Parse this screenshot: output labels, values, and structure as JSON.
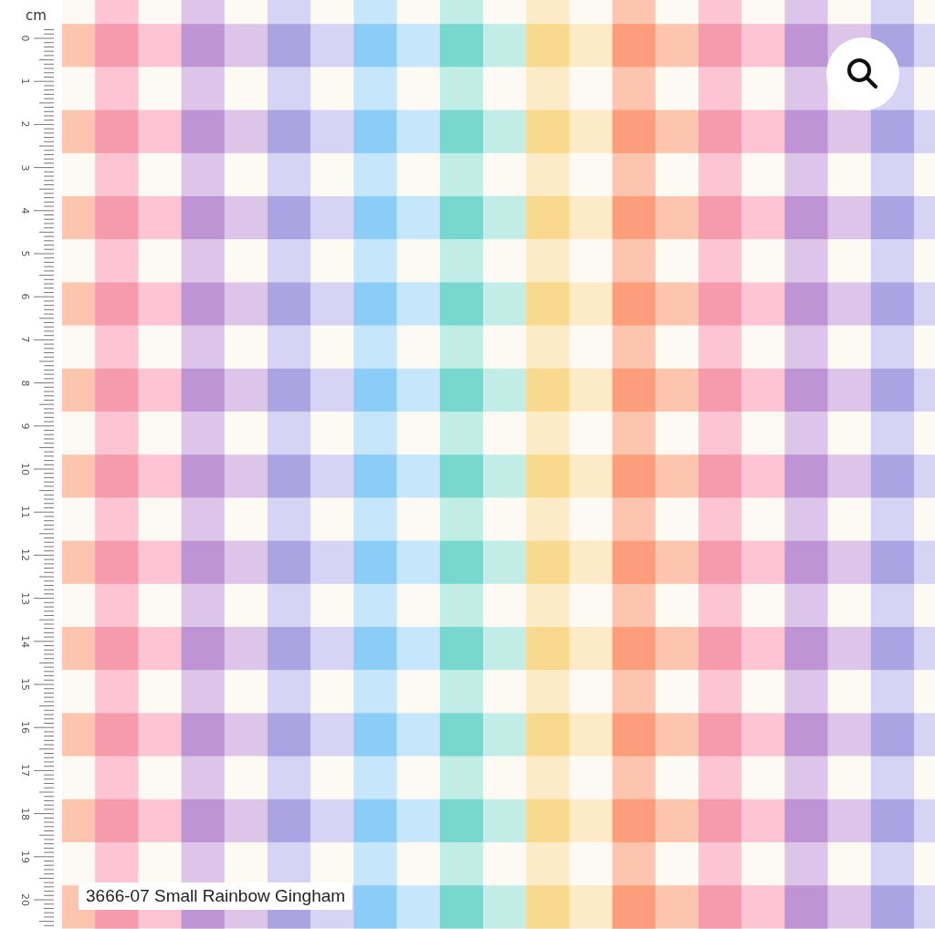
{
  "ruler": {
    "unit": "cm",
    "numbers": [
      "0",
      "1",
      "2",
      "3",
      "4",
      "5",
      "6",
      "7",
      "8",
      "9",
      "10",
      "11",
      "12",
      "13",
      "14",
      "15",
      "16",
      "17",
      "18",
      "19",
      "20"
    ]
  },
  "product_label": "3666-07 Small Rainbow Gingham"
}
